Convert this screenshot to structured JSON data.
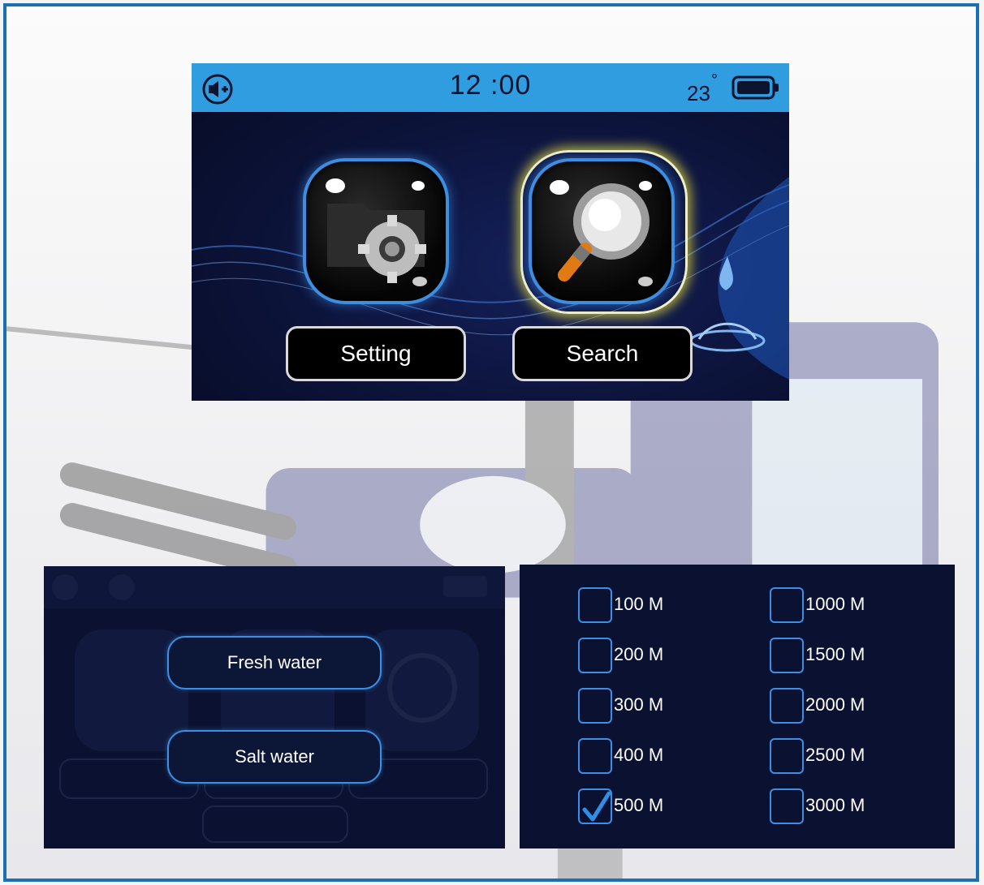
{
  "colors": {
    "frame_border": "#1a6fb5",
    "status_bar": "#2f9de0",
    "screen_bg": "#0b1130",
    "accent_blue": "#3b8fe6",
    "highlight": "#e6dc3c"
  },
  "main_screen": {
    "status_bar": {
      "volume_icon": "volume-icon",
      "time": "12 :00",
      "temperature": "23",
      "degree_symbol": "°",
      "battery_icon": "battery-icon"
    },
    "apps": [
      {
        "label": "Setting",
        "icon": "folder-gear-icon",
        "selected": false
      },
      {
        "label": "Search",
        "icon": "magnifier-icon",
        "selected": true
      }
    ]
  },
  "water_screen": {
    "buttons": [
      {
        "label": "Fresh water"
      },
      {
        "label": "Salt water"
      }
    ]
  },
  "range_screen": {
    "left_column": [
      {
        "label": "100 M",
        "checked": false
      },
      {
        "label": "200 M",
        "checked": false
      },
      {
        "label": "300 M",
        "checked": false
      },
      {
        "label": "400 M",
        "checked": false
      },
      {
        "label": "500 M",
        "checked": true
      }
    ],
    "right_column": [
      {
        "label": "1000 M",
        "checked": false
      },
      {
        "label": "1500 M",
        "checked": false
      },
      {
        "label": "2000 M",
        "checked": false
      },
      {
        "label": "2500 M",
        "checked": false
      },
      {
        "label": "3000 M",
        "checked": false
      }
    ]
  }
}
